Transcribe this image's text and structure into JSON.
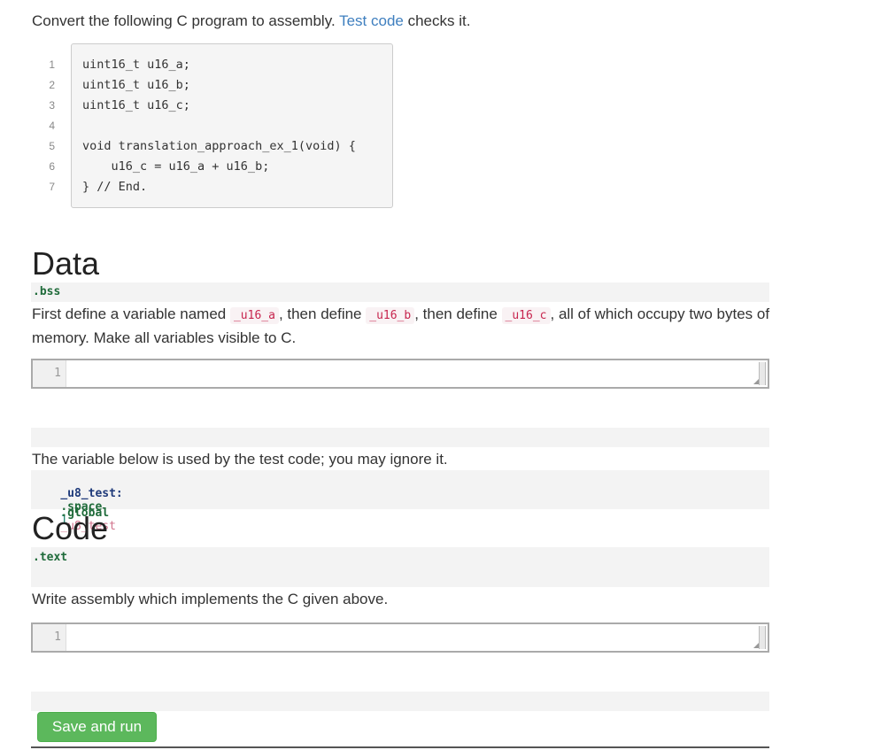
{
  "intro": {
    "prefix": "Convert the following C program to assembly.",
    "link": "Test code",
    "suffix": "checks it."
  },
  "c_program": {
    "line_numbers": [
      "1",
      "2",
      "3",
      "4",
      "5",
      "6",
      "7"
    ],
    "lines": [
      "uint16_t u16_a;",
      "uint16_t u16_b;",
      "uint16_t u16_c;",
      "",
      "void translation_approach_ex_1(void) {",
      "    u16_c = u16_a + u16_b;",
      "} // End."
    ]
  },
  "data_section": {
    "heading": "Data",
    "directive": ".bss",
    "instruction": {
      "t1": "First define a variable named",
      "v1": "_u16_a",
      "t2": ", then define",
      "v2": "_u16_b",
      "t3": ", then define",
      "v3": "_u16_c",
      "t4": ", all of which occupy two bytes of memory. Make all variables visible to C."
    },
    "editor_line": "1",
    "test_note": "The variable below is used by the test code; you may ignore it.",
    "test_label": "_u8_test:",
    "test_directive": ".space",
    "test_size": "1",
    "global_directive": ".global",
    "global_symbol": "_u8_test"
  },
  "code_section": {
    "heading": "Code",
    "directive": ".text",
    "instruction": "Write assembly which implements the C given above.",
    "editor_line": "1"
  },
  "save_button": "Save and run"
}
